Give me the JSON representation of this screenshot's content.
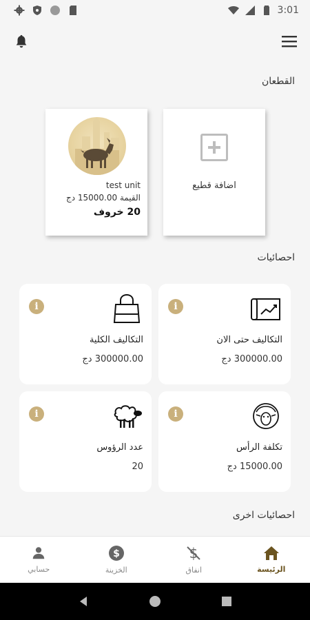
{
  "status_bar": {
    "time": "3:01"
  },
  "sections": {
    "units_title": "القطعان",
    "stats_title": "احصائيات",
    "other_stats_title": "احصائيات اخرى"
  },
  "add_unit": {
    "label": "اضافة قطيع"
  },
  "unit": {
    "name": "test unit",
    "price": "القيمة 15000.00 دج",
    "count": "20 خروف"
  },
  "stats": [
    {
      "label": "التكاليف حتى الان",
      "value": "300000.00 دج",
      "icon": "chart-icon"
    },
    {
      "label": "التكاليف الكلية",
      "value": "300000.00 دج",
      "icon": "bag-icon"
    },
    {
      "label": "تكلفة الرأس",
      "value": "15000.00 دج",
      "icon": "sheep-head-icon"
    },
    {
      "label": "عدد الرؤوس",
      "value": "20",
      "icon": "sheep-icon"
    }
  ],
  "bottom_nav": [
    {
      "label": "الرئيسة",
      "icon": "home-icon",
      "active": true
    },
    {
      "label": "انفاق",
      "icon": "dollar-icon",
      "active": false
    },
    {
      "label": "الخزينة",
      "icon": "coin-icon",
      "active": false
    },
    {
      "label": "حسابي",
      "icon": "person-icon",
      "active": false
    }
  ],
  "colors": {
    "accent": "#6b5420",
    "info": "#c9b07c",
    "background": "#f5f5f5"
  }
}
